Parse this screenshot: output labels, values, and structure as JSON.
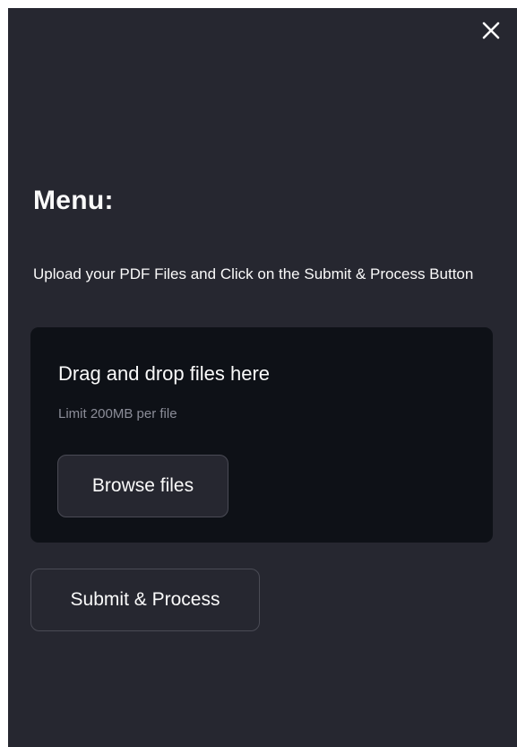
{
  "sidebar": {
    "close_icon": "close-icon",
    "title": "Menu:",
    "description": "Upload your PDF Files and Click on the Submit & Process Button",
    "uploader": {
      "drop_text": "Drag and drop files here",
      "limit_text": "Limit 200MB per file",
      "browse_label": "Browse files"
    },
    "submit_label": "Submit & Process"
  },
  "colors": {
    "sidebar_bg": "#262730",
    "dropzone_bg": "#0e1117",
    "text": "#fafafa",
    "muted_text": "#8b8d98",
    "button_border": "#4a4b55"
  }
}
